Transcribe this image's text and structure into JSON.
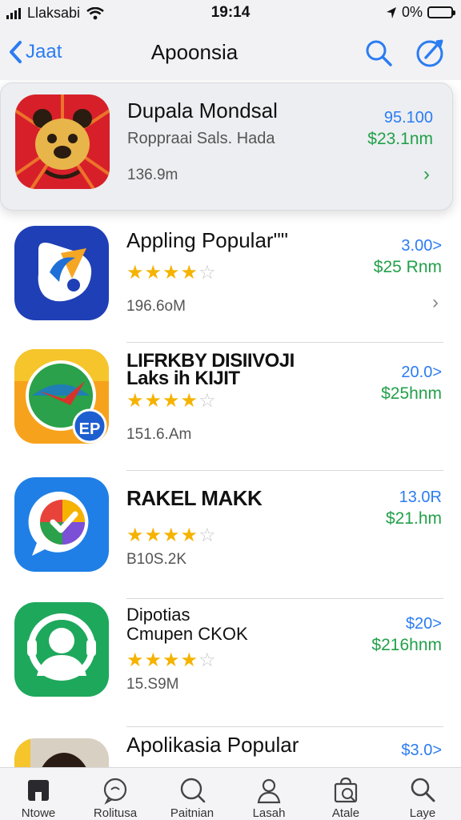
{
  "status_bar": {
    "carrier": "Llaksabi",
    "time": "19:14",
    "battery_text": "0%",
    "battery_level": 0.85,
    "battery_color": "#d81f26"
  },
  "nav": {
    "back_label": "Jaat",
    "title": "Apoonsia",
    "accent_color": "#2b7cf2"
  },
  "apps": [
    {
      "name": "Dupala Mondsal",
      "subtitle": "Roppraai Sals. Hada",
      "size": "136.9m",
      "price_top": "95.100",
      "price_bottom": "$23.1nm",
      "icon": "bear-icon",
      "chevron": "chevron-right-icon",
      "featured": true
    },
    {
      "name": "Appling Popular\"\"",
      "rating": 4,
      "size": "196.6oM",
      "price_top": "3.00>",
      "price_bottom": "$25 Rnm",
      "icon": "b-logo-icon",
      "chevron": "chevron-right-icon"
    },
    {
      "name": "LIFRKBY DISIIVOJI\nLaks ih KIJIT",
      "rating": 4,
      "size": "151.6.Am",
      "price_top": "20.0>",
      "price_bottom": "$25hnm",
      "icon": "globe-bird-icon",
      "badge": "EP"
    },
    {
      "name": "RAKEL MAKK",
      "rating": 4,
      "size": "B10S.2K",
      "price_top": "13.0R",
      "price_bottom": "$21.hm",
      "icon": "chat-check-icon"
    },
    {
      "name": "Dipotias\nCmupen CKOK",
      "rating": 4,
      "size": "15.S9M",
      "price_top": "$20>",
      "price_bottom": "$216hnm",
      "icon": "person-headset-icon"
    },
    {
      "name": "Apolikasia Popular",
      "price_top": "$3.0>",
      "icon": "portrait-icon"
    }
  ],
  "tabs": [
    {
      "label": "Ntowe",
      "icon": "home-icon"
    },
    {
      "label": "Rolitusa",
      "icon": "chat-bubble-icon"
    },
    {
      "label": "Paitnian",
      "icon": "search-bubble-icon"
    },
    {
      "label": "Lasah",
      "icon": "person-icon"
    },
    {
      "label": "Atale",
      "icon": "store-icon"
    },
    {
      "label": "Laye",
      "icon": "search-icon"
    }
  ],
  "colors": {
    "price_blue": "#2b7cf2",
    "price_green": "#23a04a",
    "star": "#f5b300"
  }
}
